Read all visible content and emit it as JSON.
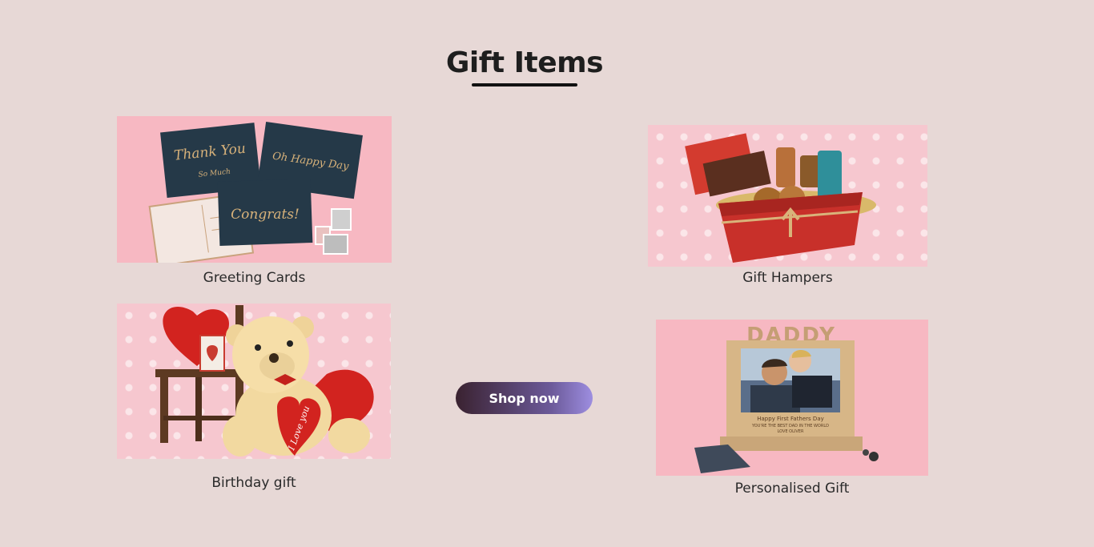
{
  "section": {
    "title": "Gift Items"
  },
  "products": [
    {
      "label": "Greeting Cards"
    },
    {
      "label": "Gift Hampers"
    },
    {
      "label": "Birthday gift"
    },
    {
      "label": "Personalised Gift"
    }
  ],
  "image_text": {
    "card_thank_you": "Thank You",
    "card_so_much": "So Much",
    "card_happy_day": "Oh Happy Day",
    "card_congrats": "Congrats!",
    "teddy_heart": "I Love you",
    "frame_daddy": "DADDY",
    "frame_caption": "Happy First Fathers Day",
    "frame_line2": "YOU'RE THE BEST DAD IN THE WORLD",
    "frame_name": "LOVE OLIVER"
  },
  "cta": {
    "label": "Shop now"
  },
  "colors": {
    "background": "#e7d8d6",
    "button_gradient_start": "#3a2230",
    "button_gradient_end": "#9d8ee0"
  }
}
